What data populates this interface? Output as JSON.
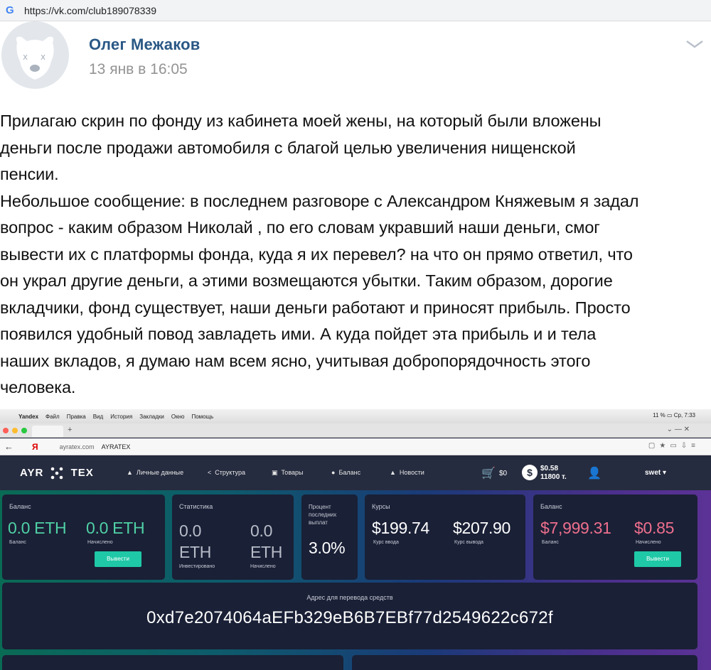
{
  "browser": {
    "url": "https://vk.com/club189078339"
  },
  "post": {
    "author": "Олег Межаков",
    "date": "13 янв в 16:05",
    "text": "Прилагаю скрин по фонду из кабинета моей жены, на который были вложены\nденьги после продажи автомобиля с благой целью увеличения нищенской\nпенсии.\nНебольшое сообщение: в последнем разговоре с Александром Княжевым я задал\nвопрос - каким образом Николай , по его словам укравший наши деньги, смог\nвывести их с платформы фонда, куда я их перевел? на что он прямо ответил, что\nон украл другие деньги, а этими возмещаются убытки. Таким образом, дорогие\nвкладчики, фонд существует, наши деньги работают и приносят прибыль. Просто\nпоявился удобный повод завладеть ими. А куда пойдет эта прибыль и и тела\nнаших вкладов, я думаю нам всем ясно, учитывая добропорядочность этого\nчеловека."
  },
  "screenshot": {
    "macmenu": [
      "Yandex",
      "Файл",
      "Правка",
      "Вид",
      "История",
      "Закладки",
      "Окно",
      "Помощь"
    ],
    "macmenu_right": "11 % ▭  Ср, 7:33",
    "address_domain": "ayratex.com",
    "address_title": "AYRATEX",
    "site": {
      "logo_left": "AYR",
      "logo_right": "TEX",
      "nav": [
        "Личные данные",
        "Структура",
        "Товары",
        "Баланс",
        "Новости"
      ],
      "cart_value": "$0",
      "balance_usd": "$0.58",
      "balance_t": "11800 т.",
      "username": "swet"
    },
    "cards": {
      "balance_eth": {
        "title": "Баланс",
        "v1": "0.0 ETH",
        "l1": "Баланс",
        "v2": "0.0 ETH",
        "l2": "Начислено",
        "button": "Вывести"
      },
      "stats": {
        "title": "Статистика",
        "v1a": "0.0",
        "v1b": "ETH",
        "l1": "Инвестировано",
        "v2a": "0.0",
        "v2b": "ETH",
        "l2": "Начислено"
      },
      "percent": {
        "title": "Процент последних выплат",
        "value": "3.0%"
      },
      "rates": {
        "title": "Курсы",
        "v1": "$199.74",
        "l1": "Курс ввода",
        "v2": "$207.90",
        "l2": "Курс вывода"
      },
      "balance_usd": {
        "title": "Баланс",
        "v1": "$7,999.31",
        "l1": "Баланс",
        "v2": "$0.85",
        "l2": "Начислено",
        "button": "Вывести"
      }
    },
    "wallet": {
      "label": "Адрес для перевода средств",
      "address": "0xd7e2074064aEFb329eB6B7EBf77d2549622c672f"
    }
  }
}
